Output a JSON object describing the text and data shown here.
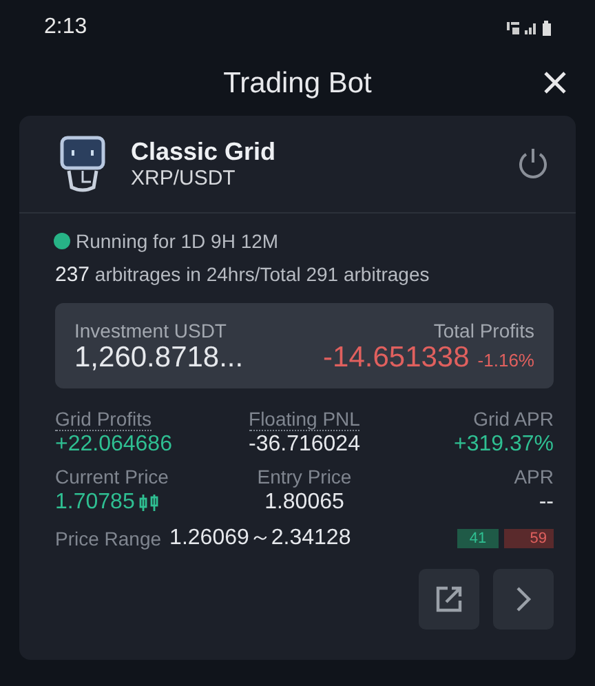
{
  "status_bar": {
    "time": "2:13"
  },
  "header": {
    "title": "Trading Bot"
  },
  "bot": {
    "name": "Classic Grid",
    "pair": "XRP/USDT",
    "running": true,
    "running_text": "Running for 1D 9H 12M",
    "arbitrage_count": "237",
    "arbitrage_text": "arbitrages in 24hrs/Total 291 arbitrages",
    "summary": {
      "investment_label": "Investment USDT",
      "investment_value": "1,260.8718...",
      "profits_label": "Total Profits",
      "profits_value": "-14.651338",
      "profits_percent": "-1.16%"
    },
    "stats": [
      {
        "label": "Grid Profits",
        "value": "+22.064686",
        "dotted": true,
        "color": "#2fbf92"
      },
      {
        "label": "Floating PNL",
        "value": "-36.716024",
        "dotted": true,
        "color": "#e6e8ec"
      },
      {
        "label": "Grid APR",
        "value": "+319.37%",
        "dotted": false,
        "color": "#2fbf92"
      },
      {
        "label": "Current Price",
        "value": "1.70785",
        "dotted": false,
        "color": "#2fbf92",
        "chart_icon": true
      },
      {
        "label": "Entry Price",
        "value": "1.80065",
        "dotted": false,
        "color": "#e6e8ec"
      },
      {
        "label": "APR",
        "value": "--",
        "dotted": false,
        "color": "#e6e8ec"
      }
    ],
    "price_range": {
      "label": "Price Range",
      "value": "1.26069～2.34128"
    },
    "ratio": [
      {
        "text": "41",
        "color": "#1f5a47"
      },
      {
        "text": "59",
        "color": "#5a2a2c"
      }
    ]
  }
}
